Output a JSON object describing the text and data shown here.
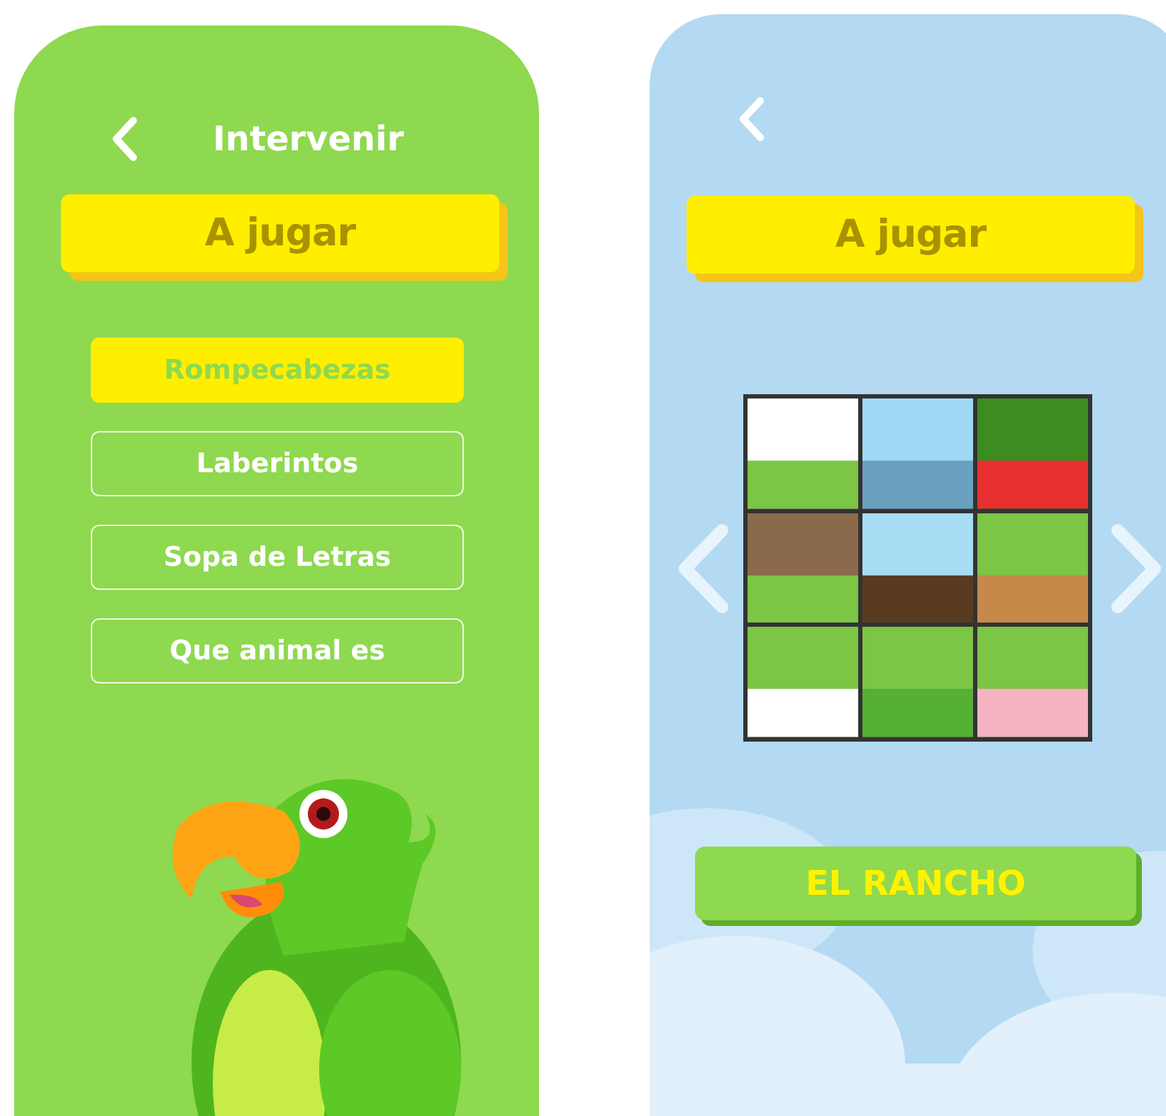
{
  "left_screen": {
    "title": "Intervenir",
    "banner": "A jugar",
    "menu": [
      {
        "label": "Rompecabezas",
        "selected": true
      },
      {
        "label": "Laberintos",
        "selected": false
      },
      {
        "label": "Sopa de Letras",
        "selected": false
      },
      {
        "label": "Que animal es",
        "selected": false
      }
    ]
  },
  "right_screen": {
    "banner": "A jugar",
    "button": "EL RANCHO"
  }
}
